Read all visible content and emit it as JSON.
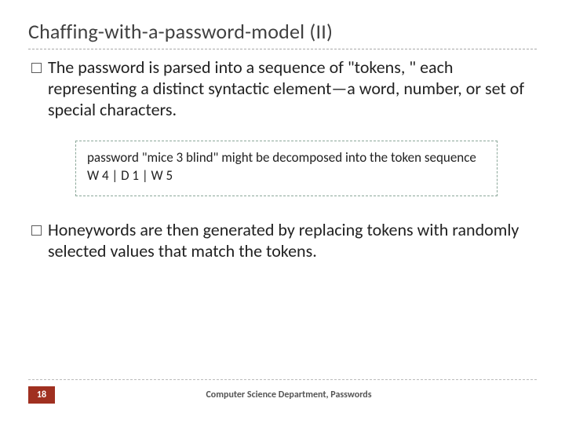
{
  "title": "Chaffing-with-a-password-model (II)",
  "bullets": [
    "The password is parsed into a sequence of \"tokens, \" each representing a distinct syntactic element—a word, number, or set of special characters.",
    "Honeywords are then generated by replacing tokens with randomly selected values that match the tokens."
  ],
  "example": "password \"mice 3 blind\" might be decomposed into the token sequence   W 4 | D 1 | W 5",
  "footer": {
    "page": "18",
    "text": "Computer Science Department, Passwords"
  }
}
